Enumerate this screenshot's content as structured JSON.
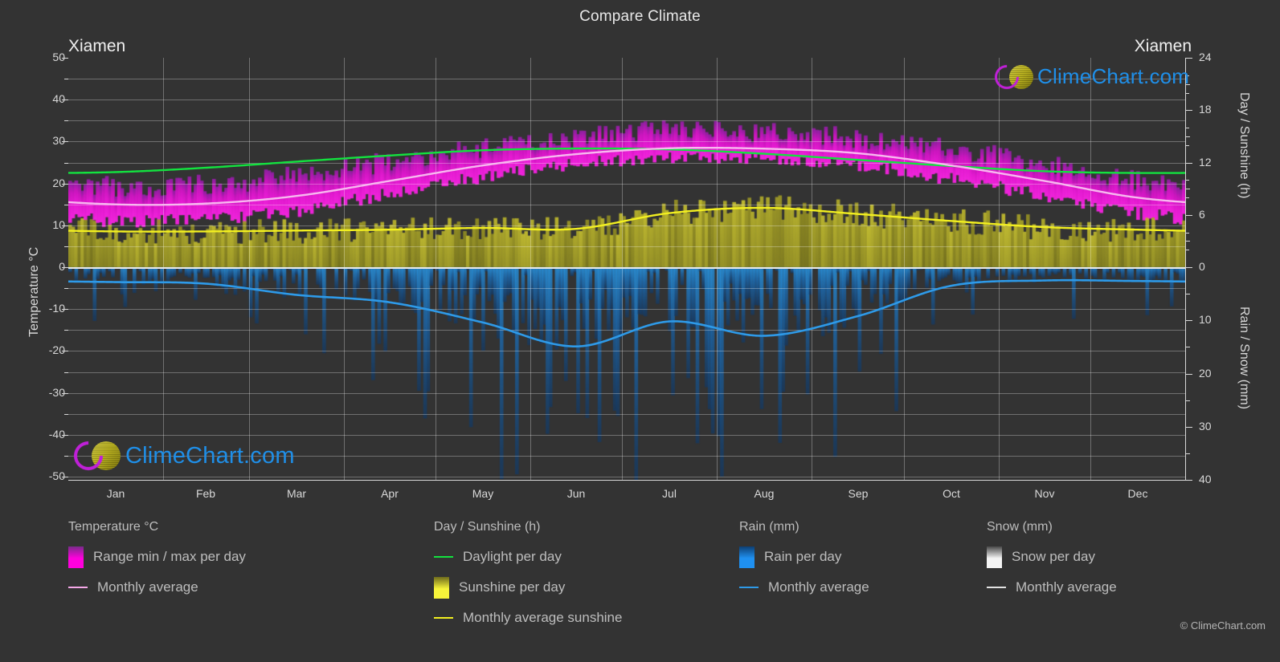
{
  "header": {
    "title": "Compare Climate",
    "location_left": "Xiamen",
    "location_right": "Xiamen"
  },
  "watermark": {
    "text": "ClimeChart.com",
    "copyright": "© ClimeChart.com"
  },
  "axes": {
    "left_label": "Temperature °C",
    "right_top_label": "Day / Sunshine (h)",
    "right_bottom_label": "Rain / Snow (mm)",
    "left_ticks": [
      "50",
      "40",
      "30",
      "20",
      "10",
      "0",
      "-10",
      "-20",
      "-30",
      "-40",
      "-50"
    ],
    "right_top_ticks": [
      "24",
      "18",
      "12",
      "6",
      "0"
    ],
    "right_bottom_ticks": [
      "0",
      "10",
      "20",
      "30",
      "40"
    ],
    "x_ticks": [
      "Jan",
      "Feb",
      "Mar",
      "Apr",
      "May",
      "Jun",
      "Jul",
      "Aug",
      "Sep",
      "Oct",
      "Nov",
      "Dec"
    ]
  },
  "legend": {
    "groups": [
      {
        "title": "Temperature °C",
        "items": [
          {
            "label": "Range min / max per day",
            "marker": "swatch",
            "color": "#ff00dd",
            "color2": "#7a2a8a"
          },
          {
            "label": "Monthly average",
            "marker": "line",
            "color": "#f5a8e8"
          }
        ]
      },
      {
        "title": "Day / Sunshine (h)",
        "items": [
          {
            "label": "Daylight per day",
            "marker": "line",
            "color": "#13e23f"
          },
          {
            "label": "Sunshine per day",
            "marker": "swatch",
            "color": "#f7f43a",
            "color2": "#6e6a1c"
          },
          {
            "label": "Monthly average sunshine",
            "marker": "line",
            "color": "#f2ef20"
          }
        ]
      },
      {
        "title": "Rain (mm)",
        "items": [
          {
            "label": "Rain per day",
            "marker": "swatch",
            "color": "#1f90f0",
            "color2": "#0d3f73"
          },
          {
            "label": "Monthly average",
            "marker": "line",
            "color": "#2e9ae8"
          }
        ]
      },
      {
        "title": "Snow (mm)",
        "items": [
          {
            "label": "Snow per day",
            "marker": "swatch",
            "color": "#f4f4f4",
            "color2": "#4a4a4a"
          },
          {
            "label": "Monthly average",
            "marker": "line",
            "color": "#e2e2e2"
          }
        ]
      }
    ]
  },
  "colors": {
    "background": "#333333",
    "grid": "#8c8c8c",
    "axis_text": "#d8d8d8",
    "temp_range": "#d715c8",
    "temp_avg_line": "#f7b8ef",
    "daylight_line": "#13e23f",
    "sunshine_fill": "#a7a32e",
    "sunshine_avg_line": "#f2ef20",
    "rain_fill": "#1f7fc4",
    "rain_avg_line": "#2e9ae8",
    "brand_blue": "#1f8fe8",
    "brand_magenta": "#c020d8",
    "brand_yellow": "#d6cf22"
  },
  "chart_data": {
    "type": "area",
    "title": "Compare Climate",
    "subtitle": "Xiamen",
    "xlabel": "",
    "ylabel": "Temperature °C",
    "ylabel_right_top": "Day / Sunshine (h)",
    "ylabel_right_bottom": "Rain / Snow (mm)",
    "grid": true,
    "legend_position": "bottom",
    "categories": [
      "Jan",
      "Feb",
      "Mar",
      "Apr",
      "May",
      "Jun",
      "Jul",
      "Aug",
      "Sep",
      "Oct",
      "Nov",
      "Dec"
    ],
    "ylim_temp": [
      -50,
      50
    ],
    "ylim_daylight": [
      0,
      24
    ],
    "ylim_rain": [
      0,
      40
    ],
    "axis_split_value": 0,
    "series": [
      {
        "name": "Monthly average temperature",
        "unit": "°C",
        "color": "#f7b8ef",
        "axis": "temperature",
        "values": [
          15.0,
          15.2,
          17.0,
          20.6,
          24.3,
          27.0,
          28.4,
          28.3,
          27.2,
          24.3,
          20.6,
          16.6
        ]
      },
      {
        "name": "Daylight per day",
        "unit": "h",
        "color": "#13e23f",
        "axis": "daylight",
        "values": [
          10.9,
          11.4,
          12.1,
          12.8,
          13.4,
          13.6,
          13.5,
          13.0,
          12.3,
          11.6,
          11.0,
          10.8
        ]
      },
      {
        "name": "Monthly average sunshine",
        "unit": "h",
        "color": "#f2ef20",
        "axis": "daylight",
        "values": [
          4.1,
          4.1,
          4.2,
          4.3,
          4.5,
          4.4,
          6.2,
          6.8,
          6.1,
          5.3,
          4.6,
          4.3
        ]
      },
      {
        "name": "Monthly average rain",
        "unit": "mm",
        "color": "#2e9ae8",
        "axis": "rain",
        "values": [
          2.8,
          3.1,
          5.2,
          6.6,
          10.4,
          14.9,
          10.2,
          12.9,
          9.2,
          3.5,
          2.5,
          2.6
        ]
      },
      {
        "name": "Daily temperature min / max range",
        "unit": "°C",
        "color": "#d715c8",
        "axis": "temperature",
        "values_min": [
          11.0,
          11.5,
          13.5,
          17.5,
          21.5,
          24.5,
          26.0,
          25.8,
          24.5,
          21.0,
          17.0,
          12.8
        ],
        "values_max": [
          19.0,
          19.5,
          21.5,
          25.0,
          28.0,
          30.5,
          32.5,
          32.0,
          30.5,
          28.0,
          24.5,
          20.5
        ]
      },
      {
        "name": "Sunshine per day",
        "unit": "h",
        "color": "#a7a32e",
        "axis": "daylight",
        "values": [
          4.1,
          4.1,
          4.2,
          4.3,
          4.5,
          4.4,
          6.2,
          6.8,
          6.1,
          5.3,
          4.6,
          4.3
        ]
      },
      {
        "name": "Rain per day",
        "unit": "mm",
        "color": "#1f7fc4",
        "axis": "rain",
        "values": [
          2.8,
          3.1,
          5.2,
          6.6,
          10.4,
          14.9,
          10.2,
          12.9,
          9.2,
          3.5,
          2.5,
          2.6
        ]
      },
      {
        "name": "Snow per day",
        "unit": "mm",
        "color": "#f4f4f4",
        "axis": "rain",
        "values": [
          0,
          0,
          0,
          0,
          0,
          0,
          0,
          0,
          0,
          0,
          0,
          0
        ]
      }
    ]
  }
}
